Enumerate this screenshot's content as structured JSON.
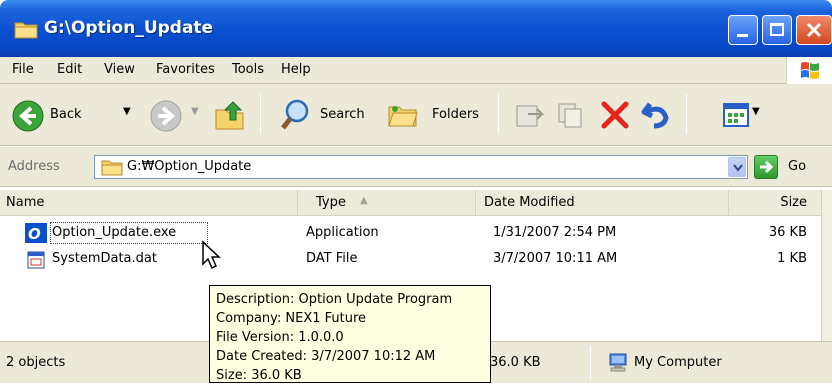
{
  "window": {
    "title": "G:\\Option_Update"
  },
  "menu": {
    "items": [
      "File",
      "Edit",
      "View",
      "Favorites",
      "Tools",
      "Help"
    ]
  },
  "toolbar": {
    "back_label": "Back",
    "search_label": "Search",
    "folders_label": "Folders"
  },
  "address": {
    "label": "Address",
    "path": "G:₩Option_Update",
    "go_label": "Go"
  },
  "columns": {
    "name": "Name",
    "type": "Type",
    "date": "Date Modified",
    "size": "Size"
  },
  "files": [
    {
      "name": "Option_Update.exe",
      "type": "Application",
      "date": "1/31/2007 2:54 PM",
      "size": "36 KB"
    },
    {
      "name": "SystemData.dat",
      "type": "DAT File",
      "date": "3/7/2007 10:11 AM",
      "size": "1 KB"
    }
  ],
  "tooltip": {
    "lines": [
      "Description: Option Update Program",
      "Company: NEX1 Future",
      "File Version: 1.0.0.0",
      "Date Created: 3/7/2007 10:12 AM",
      "Size: 36.0 KB"
    ]
  },
  "status": {
    "objects": "2 objects",
    "size": "36.0 KB",
    "location": "My Computer"
  },
  "colors": {
    "titlebar": "#0a4fd0",
    "chrome": "#ece9d8",
    "tooltip_bg": "#ffffe1",
    "close_red": "#d2461e"
  }
}
